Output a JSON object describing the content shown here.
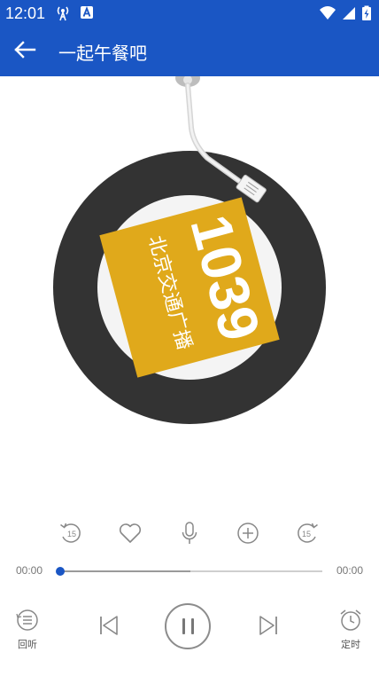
{
  "theme": {
    "brand": "#1a56c4",
    "disc": "#333333",
    "logo_bg": "#e0a91b"
  },
  "status_bar": {
    "time": "12:01",
    "left_icons": [
      "radio-tower-icon",
      "text-a-icon"
    ],
    "right_icons": [
      "wifi-icon",
      "signal-icon",
      "battery-charging-icon"
    ]
  },
  "app_bar": {
    "back_icon": "arrow-left-icon",
    "title": "一起午餐吧"
  },
  "artwork": {
    "logo_number": "1039",
    "logo_text": "北京交通广播"
  },
  "controls": {
    "items": [
      "rewind-15-icon",
      "heart-icon",
      "microphone-icon",
      "add-circle-icon",
      "forward-15-icon"
    ],
    "rewind_label": "15",
    "forward_label": "15"
  },
  "progress": {
    "current": "00:00",
    "total": "00:00",
    "position_fraction": 0.0,
    "buffered_fraction": 0.5
  },
  "bottom": {
    "playback_label": "回听",
    "timer_label": "定时",
    "state": "playing"
  }
}
